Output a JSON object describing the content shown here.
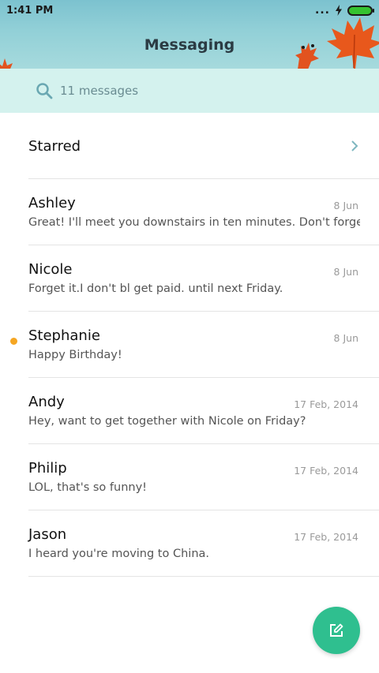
{
  "status_bar": {
    "time": "1:41 PM",
    "overflow": "...",
    "battery_color": "#35c22f"
  },
  "header": {
    "title": "Messaging"
  },
  "search": {
    "icon": "search-icon",
    "label": "11 messages"
  },
  "starred": {
    "label": "Starred",
    "icon": "chevron-right-icon"
  },
  "conversations": [
    {
      "name": "Ashley",
      "date": "8 Jun",
      "snippet": "Great! I'll meet you downstairs in ten minutes. Don't forge",
      "unread": false
    },
    {
      "name": "Nicole",
      "date": "8 Jun",
      "snippet": "Forget it.I don't bl get paid. until next Friday.",
      "unread": false
    },
    {
      "name": "Stephanie",
      "date": "8 Jun",
      "snippet": "Happy Birthday!",
      "unread": true
    },
    {
      "name": "Andy",
      "date": "17 Feb, 2014",
      "snippet": "Hey, want to get together with Nicole on Friday?",
      "unread": false
    },
    {
      "name": "Philip",
      "date": "17 Feb, 2014",
      "snippet": "LOL, that's so funny!",
      "unread": false
    },
    {
      "name": "Jason",
      "date": "17 Feb, 2014",
      "snippet": "I heard you're moving to China.",
      "unread": false
    }
  ],
  "fab": {
    "icon": "compose-icon",
    "color": "#2fbf8f"
  },
  "colors": {
    "search_bg": "#d4f2ee",
    "unread_dot": "#f5a623",
    "accent": "#2fbf8f"
  }
}
